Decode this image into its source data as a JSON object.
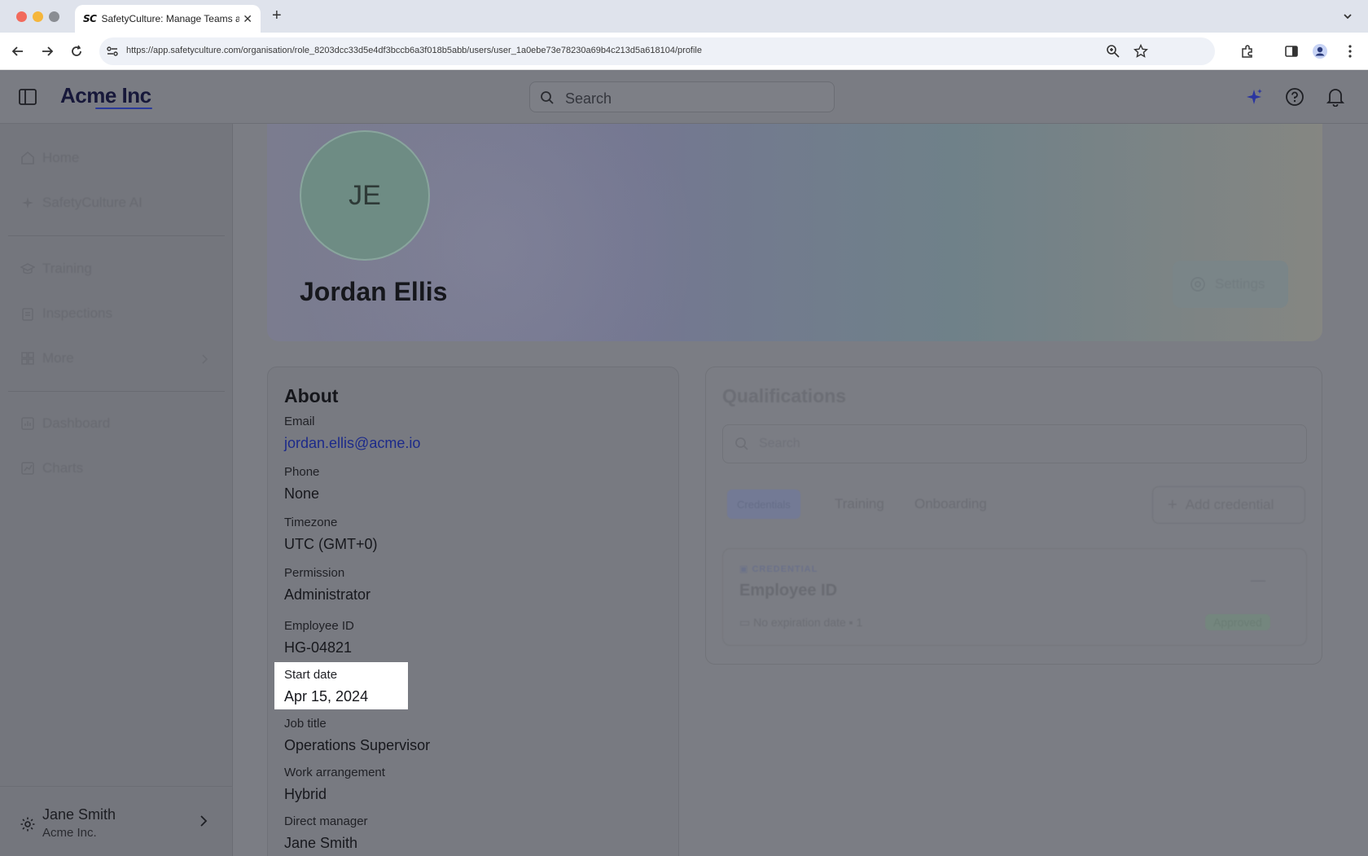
{
  "browser": {
    "tab_favicon": "SC",
    "tab_title": "SafetyCulture: Manage Teams and...",
    "tab_close": "✕",
    "new_tab": "+",
    "url": "https://app.safetyculture.com/organisation/role_8203dcc33d5e4df3bccb6a3f018b5abb/users/user_1a0ebe73e78230a69b4c213d5a618104/profile"
  },
  "header": {
    "brand": "Acme Inc",
    "search_placeholder": "Search"
  },
  "sidebar": {
    "items": [
      {
        "label": "Home",
        "icon": "home-icon"
      },
      {
        "label": "SafetyCulture AI",
        "icon": "sparkle-icon"
      },
      {
        "label": "Training",
        "icon": "training-icon"
      },
      {
        "label": "Inspections",
        "icon": "clipboard-icon"
      },
      {
        "label": "More",
        "icon": "grid-icon"
      },
      {
        "label": "Dashboard",
        "icon": "dashboard-icon"
      },
      {
        "label": "Charts",
        "icon": "chart-icon"
      }
    ],
    "user": {
      "name": "Jane Smith",
      "org": "Acme Inc."
    }
  },
  "profile": {
    "initials": "JE",
    "name": "Jordan Ellis",
    "settings_label": "Settings"
  },
  "about": {
    "title": "About",
    "fields": [
      {
        "label": "Email",
        "value": "jordan.ellis@acme.io"
      },
      {
        "label": "Phone",
        "value": "None"
      },
      {
        "label": "Timezone",
        "value": "UTC (GMT+0)"
      },
      {
        "label": "Permission",
        "value": "Administrator"
      },
      {
        "label": "Employee ID",
        "value": "HG-04821"
      },
      {
        "label": "Start date",
        "value": "Apr 15, 2024"
      },
      {
        "label": "Job title",
        "value": "Operations Supervisor"
      },
      {
        "label": "Work arrangement",
        "value": "Hybrid"
      },
      {
        "label": "Direct manager",
        "value": "Jane Smith"
      }
    ]
  },
  "qualifications": {
    "title": "Qualifications",
    "search_placeholder": "Search",
    "tabs": [
      "Credentials",
      "Training",
      "Onboarding"
    ],
    "add_label": "Add credential",
    "credential": {
      "tag": "CREDENTIAL",
      "name": "Employee ID",
      "meta": "No expiration date",
      "count": "1",
      "status": "Approved",
      "more": "—"
    }
  }
}
